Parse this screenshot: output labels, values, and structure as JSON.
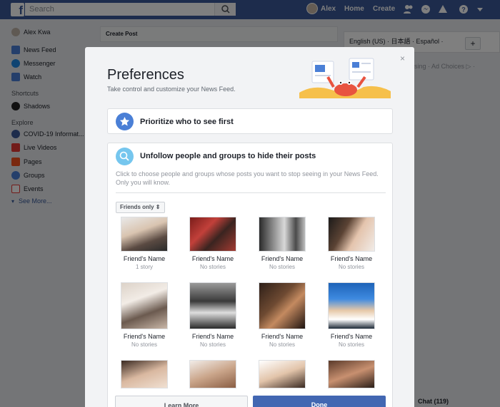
{
  "topbar": {
    "logo": "f",
    "search_placeholder": "Search",
    "user": "Alex",
    "home": "Home",
    "create": "Create"
  },
  "leftnav": {
    "profile": "Alex Kwa",
    "items": [
      {
        "label": "News Feed",
        "icon": "news-feed-icon"
      },
      {
        "label": "Messenger",
        "icon": "messenger-icon"
      },
      {
        "label": "Watch",
        "icon": "watch-icon"
      }
    ],
    "shortcuts_head": "Shortcuts",
    "shortcuts": [
      {
        "label": "Shadows",
        "icon": "shadows-icon"
      }
    ],
    "explore_head": "Explore",
    "explore": [
      {
        "label": "COVID-19 Informat...",
        "icon": "covid-icon"
      },
      {
        "label": "Live Videos",
        "icon": "live-icon"
      },
      {
        "label": "Pages",
        "icon": "pages-icon"
      },
      {
        "label": "Groups",
        "icon": "groups-icon"
      },
      {
        "label": "Events",
        "icon": "events-icon"
      }
    ],
    "see_more": "See More..."
  },
  "feed": {
    "create_post": "Create Post"
  },
  "right": {
    "languages": "English (US) · 日本語 · Español · Français (France)",
    "links": "Advertising · Ad Choices ▷ ·"
  },
  "chat": {
    "label": "Chat (119)"
  },
  "modal": {
    "close": "×",
    "title": "Preferences",
    "subtitle": "Take control and customize your News Feed.",
    "prioritize": "Prioritize who to see first",
    "unfollow_title": "Unfollow people and groups to hide their posts",
    "unfollow_desc": "Click to choose people and groups whose posts you want to stop seeing in your News Feed. Only you will know.",
    "filter": "Friends only ⇕",
    "friends": [
      {
        "name": "Friend's Name",
        "sub": "1 story"
      },
      {
        "name": "Friend's Name",
        "sub": "No stories"
      },
      {
        "name": "Friend's Name",
        "sub": "No stories"
      },
      {
        "name": "Friend's Name",
        "sub": "No stories"
      },
      {
        "name": "Friend's Name",
        "sub": "No stories"
      },
      {
        "name": "Friend's Name",
        "sub": "No stories"
      },
      {
        "name": "Friend's Name",
        "sub": "No stories"
      },
      {
        "name": "Friend's Name",
        "sub": "No stories"
      }
    ],
    "learn_more": "Learn More",
    "done": "Done"
  },
  "colors": {
    "brand": "#3b5998",
    "button": "#4267b2",
    "prioritize": "#4a7fd6",
    "unfollow": "#75c6ee"
  }
}
